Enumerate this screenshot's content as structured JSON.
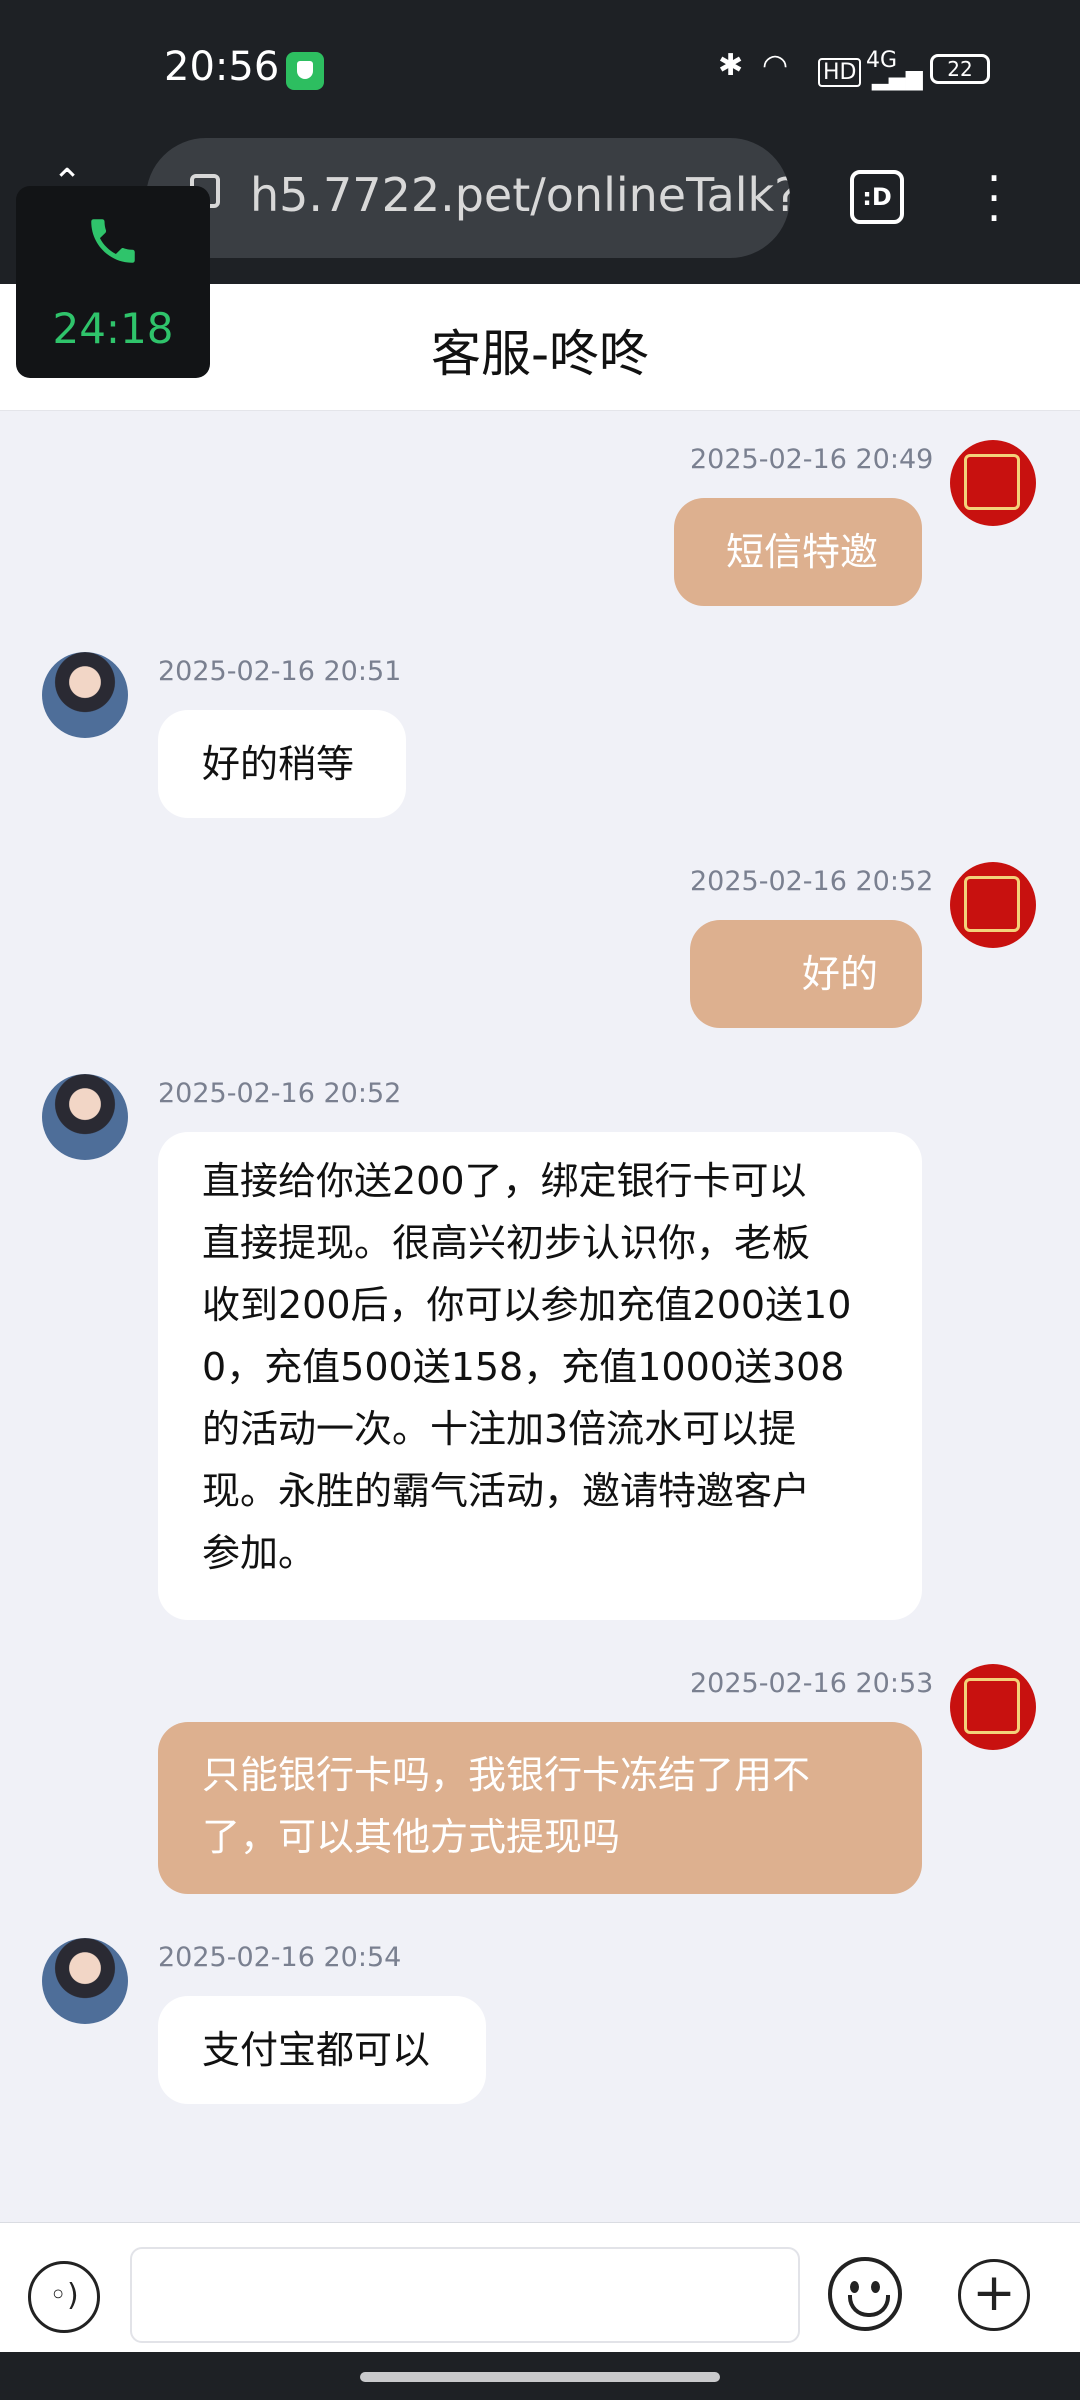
{
  "status_bar": {
    "time": "20:56",
    "network": "4G",
    "hd": "HD",
    "battery": "22"
  },
  "browser": {
    "url": "h5.7722.pet/onlineTalk?",
    "tabs_label": ":D"
  },
  "call": {
    "timer": "24:18",
    "accent": "#2FC46B"
  },
  "header": {
    "title": "客服-咚咚"
  },
  "messages": [
    {
      "side": "out",
      "time": "2025-02-16 20:49",
      "text": "短信特邀"
    },
    {
      "side": "in",
      "time": "2025-02-16 20:51",
      "text": "好的稍等"
    },
    {
      "side": "out",
      "time": "2025-02-16 20:52",
      "text": "好的"
    },
    {
      "side": "in",
      "time": "2025-02-16 20:52",
      "lines": [
        "直接给你送200了，绑定银行卡可以",
        "直接提现。很高兴初步认识你，老板",
        "收到200后，你可以参加充值200送10",
        "0，充值500送158，充值1000送308",
        "的活动一次。十注加3倍流水可以提",
        "现。永胜的霸气活动，邀请特邀客户",
        "参加。"
      ]
    },
    {
      "side": "out",
      "time": "2025-02-16 20:53",
      "lines": [
        "只能银行卡吗，我银行卡冻结了用不",
        "了，可以其他方式提现吗"
      ]
    },
    {
      "side": "in",
      "time": "2025-02-16 20:54",
      "text": "支付宝都可以"
    }
  ],
  "colors": {
    "outgoing_bubble": "#DDB08F",
    "incoming_bubble": "#FFFFFF",
    "chat_background": "#F0F1F7"
  }
}
